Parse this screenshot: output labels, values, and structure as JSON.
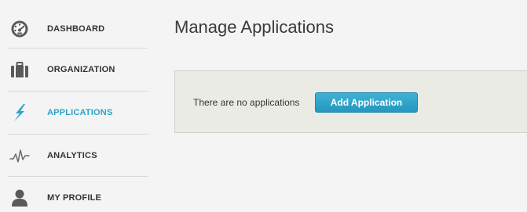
{
  "sidebar": {
    "items": [
      {
        "label": "DASHBOARD",
        "icon": "dashboard-gauge-icon",
        "active": false
      },
      {
        "label": "ORGANIZATION",
        "icon": "briefcase-icon",
        "active": false
      },
      {
        "label": "APPLICATIONS",
        "icon": "lightning-bolt-icon",
        "active": true
      },
      {
        "label": "ANALYTICS",
        "icon": "pulse-line-icon",
        "active": false
      },
      {
        "label": "MY PROFILE",
        "icon": "user-silhouette-icon",
        "active": false
      }
    ]
  },
  "main": {
    "title": "Manage Applications",
    "empty_message": "There are no applications",
    "add_button_label": "Add Application"
  },
  "colors": {
    "accent": "#2aa3c9",
    "icon_gray": "#555555",
    "panel_bg": "#ebebe6",
    "page_bg": "#f4f4f4"
  }
}
